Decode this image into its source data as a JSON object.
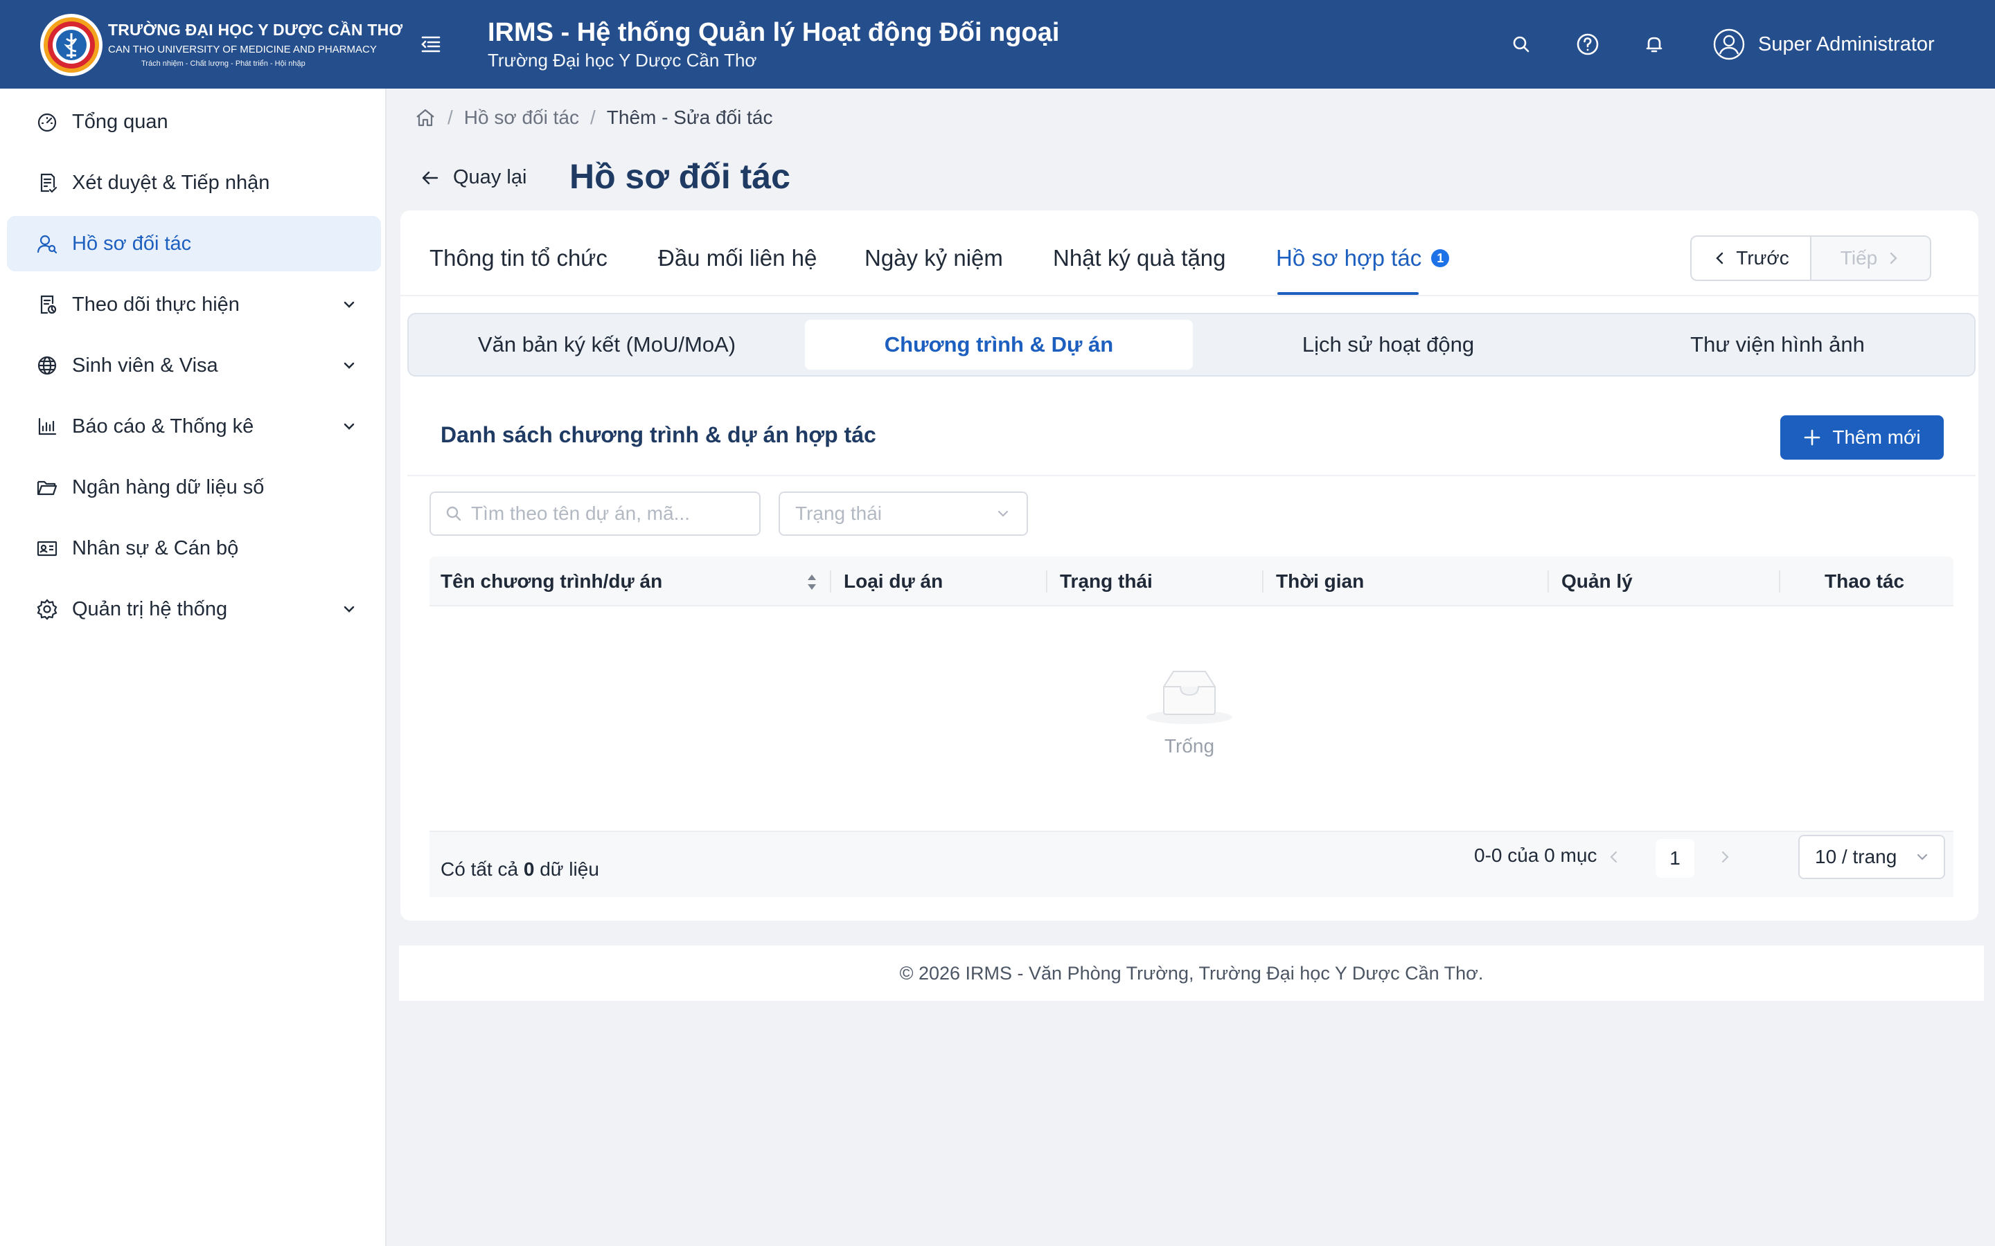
{
  "header": {
    "logo_line1": "TRƯỜNG ĐẠI HỌC Y DƯỢC CẦN THƠ",
    "logo_line2": "CAN THO UNIVERSITY OF MEDICINE AND PHARMACY",
    "logo_line3": "Trách nhiệm - Chất lượng - Phát triển - Hội nhập",
    "app_title": "IRMS - Hệ thống Quản lý Hoạt động Đối ngoại",
    "app_subtitle": "Trường Đại học Y Dược Cần Thơ",
    "user_name": "Super Administrator",
    "brand_color": "#254e8d"
  },
  "sidebar": {
    "items": [
      {
        "label": "Tổng quan",
        "icon": "dashboard-icon",
        "has_children": false,
        "active": false
      },
      {
        "label": "Xét duyệt & Tiếp nhận",
        "icon": "document-check-icon",
        "has_children": false,
        "active": false
      },
      {
        "label": "Hồ sơ đối tác",
        "icon": "partners-icon",
        "has_children": false,
        "active": true
      },
      {
        "label": "Theo dõi thực hiện",
        "icon": "tracking-icon",
        "has_children": true,
        "active": false
      },
      {
        "label": "Sinh viên & Visa",
        "icon": "globe-icon",
        "has_children": true,
        "active": false
      },
      {
        "label": "Báo cáo & Thống kê",
        "icon": "bar-chart-icon",
        "has_children": true,
        "active": false
      },
      {
        "label": "Ngân hàng dữ liệu số",
        "icon": "folder-icon",
        "has_children": false,
        "active": false
      },
      {
        "label": "Nhân sự & Cán bộ",
        "icon": "id-card-icon",
        "has_children": false,
        "active": false
      },
      {
        "label": "Quản trị hệ thống",
        "icon": "settings-icon",
        "has_children": true,
        "active": false
      }
    ]
  },
  "breadcrumb": {
    "items": [
      "Hồ sơ đối tác",
      "Thêm - Sửa đối tác"
    ]
  },
  "page": {
    "back_label": "Quay lại",
    "title": "Hồ sơ đối tác"
  },
  "tabs": {
    "items": [
      "Thông tin tổ chức",
      "Đầu mối liên hệ",
      "Ngày kỷ niệm",
      "Nhật ký quà tặng",
      "Hồ sơ hợp tác"
    ],
    "active_badge": "1",
    "prev_label": "Trước",
    "next_label": "Tiếp"
  },
  "subtabs": {
    "items": [
      "Văn bản ký kết (MoU/MoA)",
      "Chương trình & Dự án",
      "Lịch sử hoạt động",
      "Thư viện hình ảnh"
    ],
    "active_index": 1
  },
  "section": {
    "title": "Danh sách chương trình & dự án hợp tác",
    "add_label": "Thêm mới"
  },
  "filters": {
    "search_placeholder": "Tìm theo tên dự án, mã...",
    "status_placeholder": "Trạng thái"
  },
  "table": {
    "columns": [
      "Tên chương trình/dự án",
      "Loại dự án",
      "Trạng thái",
      "Thời gian",
      "Quản lý",
      "Thao tác"
    ],
    "rows": [],
    "empty_text": "Trống"
  },
  "pagination": {
    "total_prefix": "Có tất cả",
    "total_count": "0",
    "total_suffix": "dữ liệu",
    "range_text": "0-0 của 0 mục",
    "current_page": "1",
    "page_size": "10 / trang"
  },
  "footer": {
    "text": "© 2026 IRMS - Văn Phòng Trường, Trường Đại học Y Dược Cần Thơ."
  }
}
